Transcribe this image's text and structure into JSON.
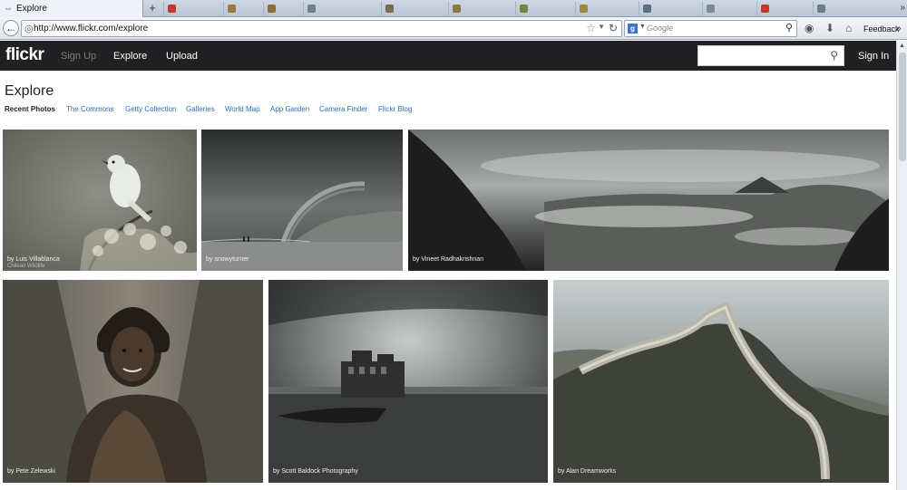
{
  "browser": {
    "active_tab": "Explore",
    "new_tab_symbol": "+",
    "url": "http://www.flickr.com/explore",
    "search_placeholder": "Google",
    "search_engine_icon": "g",
    "feedback_label": "Feedback",
    "tab_scroll_symbol": "»",
    "menu_symbol": "»"
  },
  "flickr": {
    "logo": "flickr",
    "nav": {
      "signup": "Sign Up",
      "explore": "Explore",
      "upload": "Upload"
    },
    "signin": "Sign In",
    "search_value": ""
  },
  "explore": {
    "title": "Explore",
    "tabs": [
      {
        "label": "Recent Photos"
      },
      {
        "label": "The Commons"
      },
      {
        "label": "Getty Collection"
      },
      {
        "label": "Galleries"
      },
      {
        "label": "World Map"
      },
      {
        "label": "App Garden"
      },
      {
        "label": "Camera Finder"
      },
      {
        "label": "Flickr Blog"
      }
    ]
  },
  "photos": [
    {
      "caption": "by Luis Villablanca",
      "caption_sub": "Chilean Wildlife"
    },
    {
      "caption": "by snowyturner"
    },
    {
      "caption": "by Vineet Radhakrishnan"
    },
    {
      "caption": "by Pete Zelewski"
    },
    {
      "caption": "by Scott Baldock Photography"
    },
    {
      "caption": "by Alan Dreamworks"
    }
  ],
  "colors": {
    "flickr_bar": "#212124",
    "link_blue": "#2c6fb4"
  }
}
